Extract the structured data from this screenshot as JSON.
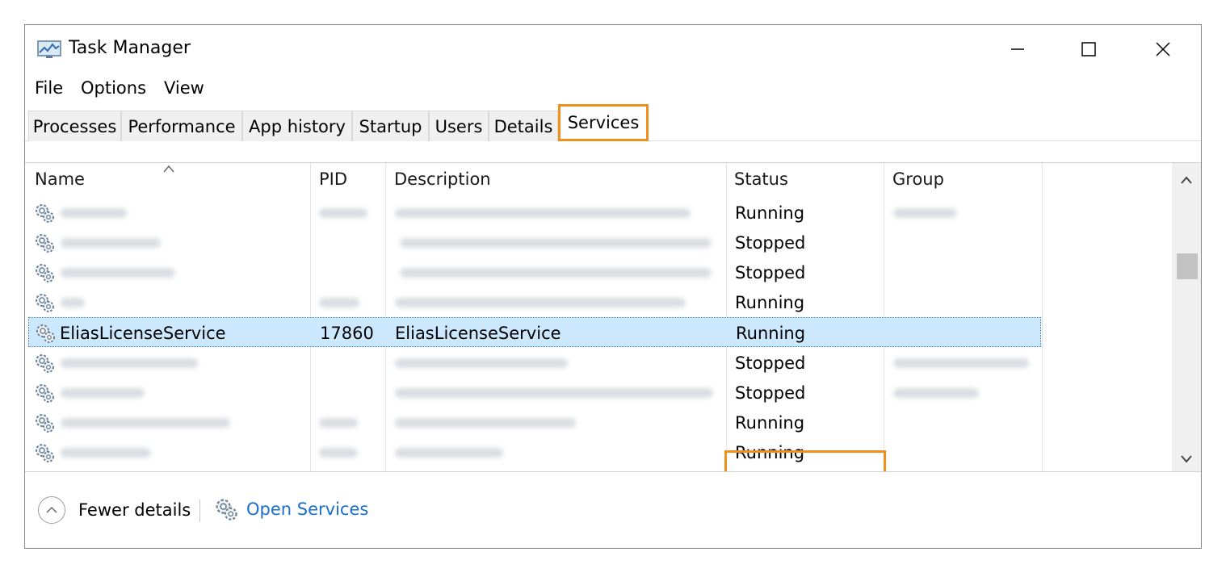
{
  "window": {
    "title": "Task Manager"
  },
  "title_controls": {
    "minimize": "minimize-icon",
    "maximize": "maximize-icon",
    "close": "close-icon"
  },
  "menu": [
    "File",
    "Options",
    "View"
  ],
  "tabs": [
    {
      "label": "Processes"
    },
    {
      "label": "Performance"
    },
    {
      "label": "App history"
    },
    {
      "label": "Startup"
    },
    {
      "label": "Users"
    },
    {
      "label": "Details"
    },
    {
      "label": "Services",
      "active": true
    }
  ],
  "columns": {
    "name": "Name",
    "pid": "PID",
    "description": "Description",
    "status": "Status",
    "group": "Group"
  },
  "rows": [
    {
      "status": "Running",
      "selected": false
    },
    {
      "status": "Stopped",
      "selected": false
    },
    {
      "status": "Stopped",
      "selected": false
    },
    {
      "status": "Running",
      "selected": false
    },
    {
      "name": "EliasLicenseService",
      "pid": "17860",
      "description": "EliasLicenseService",
      "status": "Running",
      "selected": true
    },
    {
      "status": "Stopped",
      "selected": false
    },
    {
      "status": "Stopped",
      "selected": false
    },
    {
      "status": "Running",
      "selected": false
    },
    {
      "status": "Running",
      "selected": false
    }
  ],
  "footer": {
    "fewer_details": "Fewer details",
    "open_services": "Open Services"
  },
  "colors": {
    "highlight": "#f18f1d",
    "selection": "#cce8ff",
    "link": "#1a6fc8"
  }
}
